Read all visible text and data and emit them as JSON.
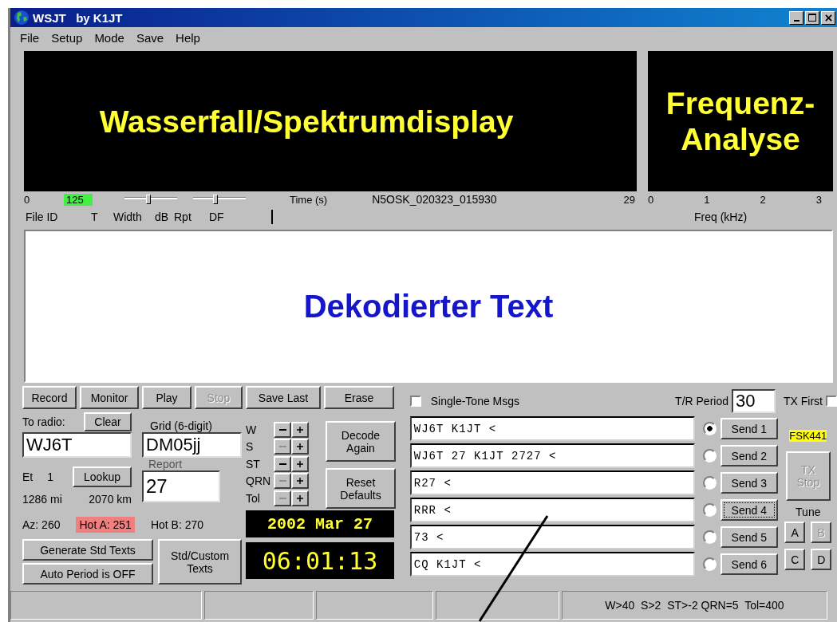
{
  "window": {
    "title": "WSJT   by K1JT"
  },
  "menu": [
    "File",
    "Setup",
    "Mode",
    "Save",
    "Help"
  ],
  "waterfall": {
    "label": "Wasserfall/Spektrumdisplay"
  },
  "spectrum": {
    "lines": [
      "Frequenz-",
      "Analyse"
    ]
  },
  "scale": {
    "start": "0",
    "marker": "125",
    "sliders": [
      {
        "level": 0.45
      },
      {
        "level": 0.43
      }
    ],
    "time_label": "Time (s)",
    "file_name": "N5OSK_020323_015930",
    "end": "29"
  },
  "freq_scale": {
    "ticks": [
      "0",
      "1",
      "2",
      "3"
    ],
    "label": "Freq (kHz)"
  },
  "legend": [
    "File ID",
    "T",
    "Width",
    "dB",
    "Rpt",
    "DF"
  ],
  "decoded_text": "Dekodierter Text",
  "buttons": [
    {
      "label": "Record",
      "disabled": false
    },
    {
      "label": "Monitor",
      "disabled": false
    },
    {
      "label": "Play",
      "disabled": false
    },
    {
      "label": "Stop",
      "disabled": true
    },
    {
      "label": "Save Last",
      "disabled": false
    },
    {
      "label": "Erase",
      "disabled": false
    }
  ],
  "to_radio": {
    "label": "To radio:",
    "value": "WJ6T"
  },
  "clear_button": {
    "label": "Clear"
  },
  "grid": {
    "label": "Grid (6-digit)",
    "value": "DM05jj"
  },
  "et": {
    "label": "Et",
    "value": "1"
  },
  "lookup_button": {
    "label": "Lookup"
  },
  "report": {
    "label": "Report",
    "value": "27"
  },
  "distance": [
    "1286 mi",
    "2070 km"
  ],
  "bearings": [
    {
      "text": "Az: 260",
      "hot": false
    },
    {
      "text": "Hot A: 251",
      "hot": true
    },
    {
      "text": "Hot B: 270",
      "hot": false
    }
  ],
  "generate_button": {
    "label": "Generate Std Texts"
  },
  "auto_period_button": {
    "label": "Auto Period is OFF"
  },
  "std_custom_button": {
    "lines": [
      "Std/Custom",
      "Texts"
    ]
  },
  "steppers": [
    {
      "label": "W",
      "minus_disabled": false
    },
    {
      "label": "S",
      "minus_disabled": true
    },
    {
      "label": "ST",
      "minus_disabled": false
    },
    {
      "label": "QRN",
      "minus_disabled": true
    },
    {
      "label": "Tol",
      "minus_disabled": true
    }
  ],
  "decode_again_button": {
    "lines": [
      "Decode",
      "Again"
    ]
  },
  "reset_defaults_button": {
    "lines": [
      "Reset",
      "Defaults"
    ]
  },
  "date": "2002 Mar 27",
  "time": "06:01:13",
  "single_tone": {
    "label": "Single-Tone Msgs",
    "checked": false
  },
  "tr_period": {
    "label": "T/R Period",
    "value": "30"
  },
  "tx_first": {
    "label": "TX First",
    "checked": false
  },
  "messages": [
    {
      "text": "WJ6T K1JT <",
      "selected": true,
      "send": "Send 1",
      "focused": false
    },
    {
      "text": "WJ6T 27 K1JT 2727 <",
      "selected": false,
      "send": "Send 2",
      "focused": false
    },
    {
      "text": "R27 <",
      "selected": false,
      "send": "Send 3",
      "focused": false
    },
    {
      "text": "RRR <",
      "selected": false,
      "send": "Send 4",
      "focused": true
    },
    {
      "text": "73 <",
      "selected": false,
      "send": "Send 5",
      "focused": false
    },
    {
      "text": "CQ K1JT <",
      "selected": false,
      "send": "Send 6",
      "focused": false
    }
  ],
  "mode_badge": "FSK441",
  "tx_stop": {
    "lines": [
      "TX",
      "Stop"
    ],
    "disabled": true
  },
  "tune": {
    "label": "Tune",
    "buttons": [
      {
        "label": "A",
        "disabled": false
      },
      {
        "label": "B",
        "disabled": true
      },
      {
        "label": "C",
        "disabled": false
      },
      {
        "label": "D",
        "disabled": false
      }
    ]
  },
  "status_bar": {
    "text": "W>40  S>2  ST>-2 QRN=5  Tol=400"
  }
}
